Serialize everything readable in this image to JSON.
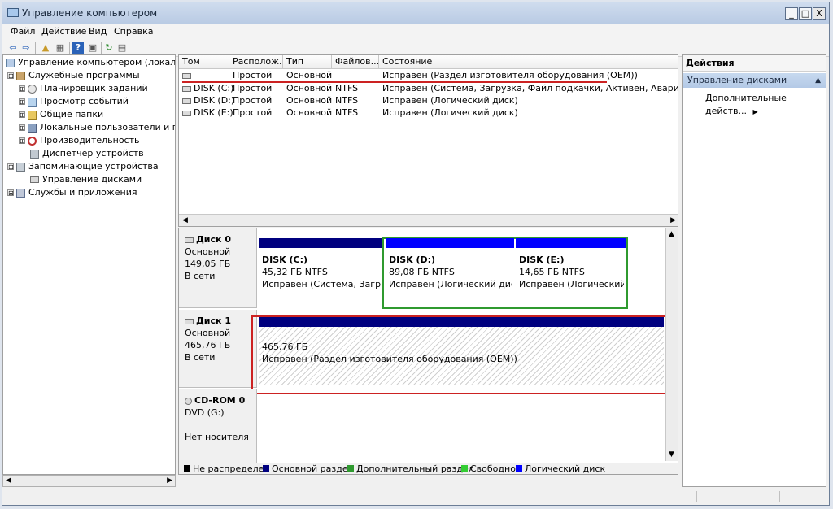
{
  "window": {
    "title": "Управление компьютером",
    "buttons": {
      "minimize": "_",
      "maximize": "□",
      "close": "X"
    }
  },
  "menu": [
    "Файл",
    "Действие",
    "Вид",
    "Справка"
  ],
  "toolbar": {
    "icons": [
      "back-arrow-icon",
      "forward-arrow-icon",
      "up-folder-icon",
      "properties-icon",
      "help-icon",
      "console-icon",
      "refresh-icon",
      "export-icon"
    ],
    "glyphs": {
      "back": "⇦",
      "forward": "⇨",
      "up": "▲",
      "props": "▦",
      "help": "?",
      "console": "▣",
      "refresh": "↻",
      "export": "▤"
    }
  },
  "tree": {
    "root": "Управление компьютером (локальны",
    "items": [
      {
        "label": "Служебные программы",
        "toggle": "⊟"
      },
      {
        "label": "Планировщик заданий",
        "toggle": "⊞"
      },
      {
        "label": "Просмотр событий",
        "toggle": "⊞"
      },
      {
        "label": "Общие папки",
        "toggle": "⊞"
      },
      {
        "label": "Локальные пользователи и груп",
        "toggle": "⊞"
      },
      {
        "label": "Производительность",
        "toggle": "⊞"
      },
      {
        "label": "Диспетчер устройств",
        "toggle": ""
      },
      {
        "label": "Запоминающие устройства",
        "toggle": "⊟"
      },
      {
        "label": "Управление дисками",
        "toggle": ""
      },
      {
        "label": "Службы и приложения",
        "toggle": "⊞"
      }
    ]
  },
  "volumes": {
    "columns": [
      "Том",
      "Располож...",
      "Тип",
      "Файлов...",
      "Состояние"
    ],
    "rows": [
      {
        "tom": "",
        "layout": "Простой",
        "type": "Основной",
        "fs": "",
        "status": "Исправен (Раздел изготовителя оборудования (OEM))"
      },
      {
        "tom": "DISK (C:)",
        "layout": "Простой",
        "type": "Основной",
        "fs": "NTFS",
        "status": "Исправен (Система, Загрузка, Файл подкачки, Активен, Аварийный дамп"
      },
      {
        "tom": "DISK (D:)",
        "layout": "Простой",
        "type": "Основной",
        "fs": "NTFS",
        "status": "Исправен (Логический диск)"
      },
      {
        "tom": "DISK (E:)",
        "layout": "Простой",
        "type": "Основной",
        "fs": "NTFS",
        "status": "Исправен (Логический диск)"
      }
    ]
  },
  "disks": {
    "disk0": {
      "name": "Диск 0",
      "type": "Основной",
      "size": "149,05 ГБ",
      "state": "В сети"
    },
    "disk0_parts": [
      {
        "title": "DISK  (C:)",
        "size": "45,32 ГБ NTFS",
        "status": "Исправен (Система, Загрузк"
      },
      {
        "title": "DISK  (D:)",
        "size": "89,08 ГБ NTFS",
        "status": "Исправен (Логический диск)"
      },
      {
        "title": "DISK  (E:)",
        "size": "14,65 ГБ NTFS",
        "status": "Исправен (Логический д"
      }
    ],
    "disk1": {
      "name": "Диск 1",
      "type": "Основной",
      "size": "465,76 ГБ",
      "state": "В сети"
    },
    "disk1_part": {
      "size": "465,76 ГБ",
      "status": "Исправен (Раздел изготовителя оборудования (OEM))"
    },
    "cdrom": {
      "name": "CD-ROM 0",
      "type": "DVD (G:)",
      "state": "Нет носителя"
    }
  },
  "legend": [
    "Не распределен",
    "Основной раздел",
    "Дополнительный раздел",
    "Свободно",
    "Логический диск"
  ],
  "colors": {
    "unallocated": "#000000",
    "primary": "#00007f",
    "extended": "#2f9a2f",
    "free": "#33cc33",
    "logical": "#0000ff",
    "highlight": "#cc2222"
  },
  "actions": {
    "header": "Действия",
    "section": "Управление дисками",
    "more": "Дополнительные действ...",
    "section_arrow": "▲",
    "more_arrow": "▶"
  }
}
